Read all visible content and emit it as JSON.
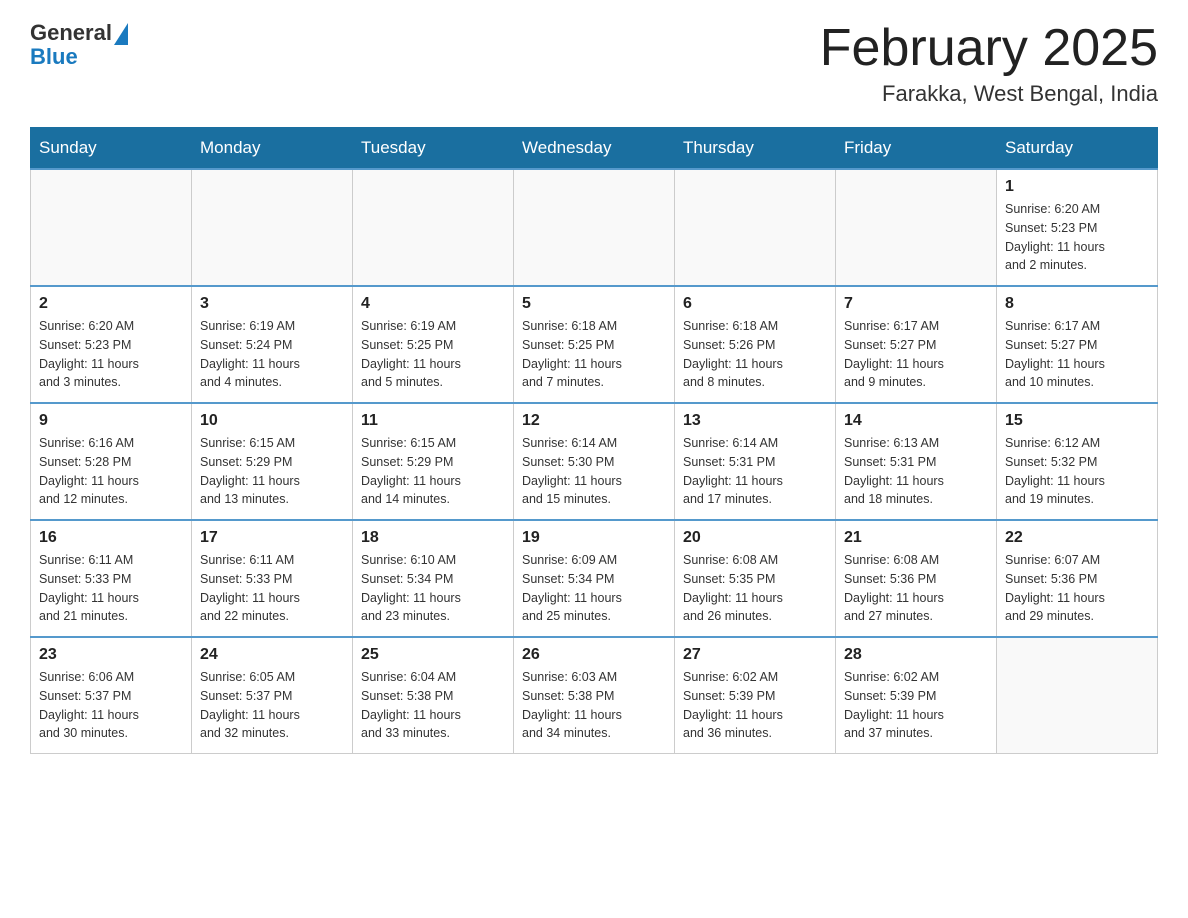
{
  "header": {
    "logo_general": "General",
    "logo_blue": "Blue",
    "month_title": "February 2025",
    "location": "Farakka, West Bengal, India"
  },
  "days_of_week": [
    "Sunday",
    "Monday",
    "Tuesday",
    "Wednesday",
    "Thursday",
    "Friday",
    "Saturday"
  ],
  "weeks": [
    [
      {
        "day": "",
        "info": ""
      },
      {
        "day": "",
        "info": ""
      },
      {
        "day": "",
        "info": ""
      },
      {
        "day": "",
        "info": ""
      },
      {
        "day": "",
        "info": ""
      },
      {
        "day": "",
        "info": ""
      },
      {
        "day": "1",
        "info": "Sunrise: 6:20 AM\nSunset: 5:23 PM\nDaylight: 11 hours\nand 2 minutes."
      }
    ],
    [
      {
        "day": "2",
        "info": "Sunrise: 6:20 AM\nSunset: 5:23 PM\nDaylight: 11 hours\nand 3 minutes."
      },
      {
        "day": "3",
        "info": "Sunrise: 6:19 AM\nSunset: 5:24 PM\nDaylight: 11 hours\nand 4 minutes."
      },
      {
        "day": "4",
        "info": "Sunrise: 6:19 AM\nSunset: 5:25 PM\nDaylight: 11 hours\nand 5 minutes."
      },
      {
        "day": "5",
        "info": "Sunrise: 6:18 AM\nSunset: 5:25 PM\nDaylight: 11 hours\nand 7 minutes."
      },
      {
        "day": "6",
        "info": "Sunrise: 6:18 AM\nSunset: 5:26 PM\nDaylight: 11 hours\nand 8 minutes."
      },
      {
        "day": "7",
        "info": "Sunrise: 6:17 AM\nSunset: 5:27 PM\nDaylight: 11 hours\nand 9 minutes."
      },
      {
        "day": "8",
        "info": "Sunrise: 6:17 AM\nSunset: 5:27 PM\nDaylight: 11 hours\nand 10 minutes."
      }
    ],
    [
      {
        "day": "9",
        "info": "Sunrise: 6:16 AM\nSunset: 5:28 PM\nDaylight: 11 hours\nand 12 minutes."
      },
      {
        "day": "10",
        "info": "Sunrise: 6:15 AM\nSunset: 5:29 PM\nDaylight: 11 hours\nand 13 minutes."
      },
      {
        "day": "11",
        "info": "Sunrise: 6:15 AM\nSunset: 5:29 PM\nDaylight: 11 hours\nand 14 minutes."
      },
      {
        "day": "12",
        "info": "Sunrise: 6:14 AM\nSunset: 5:30 PM\nDaylight: 11 hours\nand 15 minutes."
      },
      {
        "day": "13",
        "info": "Sunrise: 6:14 AM\nSunset: 5:31 PM\nDaylight: 11 hours\nand 17 minutes."
      },
      {
        "day": "14",
        "info": "Sunrise: 6:13 AM\nSunset: 5:31 PM\nDaylight: 11 hours\nand 18 minutes."
      },
      {
        "day": "15",
        "info": "Sunrise: 6:12 AM\nSunset: 5:32 PM\nDaylight: 11 hours\nand 19 minutes."
      }
    ],
    [
      {
        "day": "16",
        "info": "Sunrise: 6:11 AM\nSunset: 5:33 PM\nDaylight: 11 hours\nand 21 minutes."
      },
      {
        "day": "17",
        "info": "Sunrise: 6:11 AM\nSunset: 5:33 PM\nDaylight: 11 hours\nand 22 minutes."
      },
      {
        "day": "18",
        "info": "Sunrise: 6:10 AM\nSunset: 5:34 PM\nDaylight: 11 hours\nand 23 minutes."
      },
      {
        "day": "19",
        "info": "Sunrise: 6:09 AM\nSunset: 5:34 PM\nDaylight: 11 hours\nand 25 minutes."
      },
      {
        "day": "20",
        "info": "Sunrise: 6:08 AM\nSunset: 5:35 PM\nDaylight: 11 hours\nand 26 minutes."
      },
      {
        "day": "21",
        "info": "Sunrise: 6:08 AM\nSunset: 5:36 PM\nDaylight: 11 hours\nand 27 minutes."
      },
      {
        "day": "22",
        "info": "Sunrise: 6:07 AM\nSunset: 5:36 PM\nDaylight: 11 hours\nand 29 minutes."
      }
    ],
    [
      {
        "day": "23",
        "info": "Sunrise: 6:06 AM\nSunset: 5:37 PM\nDaylight: 11 hours\nand 30 minutes."
      },
      {
        "day": "24",
        "info": "Sunrise: 6:05 AM\nSunset: 5:37 PM\nDaylight: 11 hours\nand 32 minutes."
      },
      {
        "day": "25",
        "info": "Sunrise: 6:04 AM\nSunset: 5:38 PM\nDaylight: 11 hours\nand 33 minutes."
      },
      {
        "day": "26",
        "info": "Sunrise: 6:03 AM\nSunset: 5:38 PM\nDaylight: 11 hours\nand 34 minutes."
      },
      {
        "day": "27",
        "info": "Sunrise: 6:02 AM\nSunset: 5:39 PM\nDaylight: 11 hours\nand 36 minutes."
      },
      {
        "day": "28",
        "info": "Sunrise: 6:02 AM\nSunset: 5:39 PM\nDaylight: 11 hours\nand 37 minutes."
      },
      {
        "day": "",
        "info": ""
      }
    ]
  ]
}
